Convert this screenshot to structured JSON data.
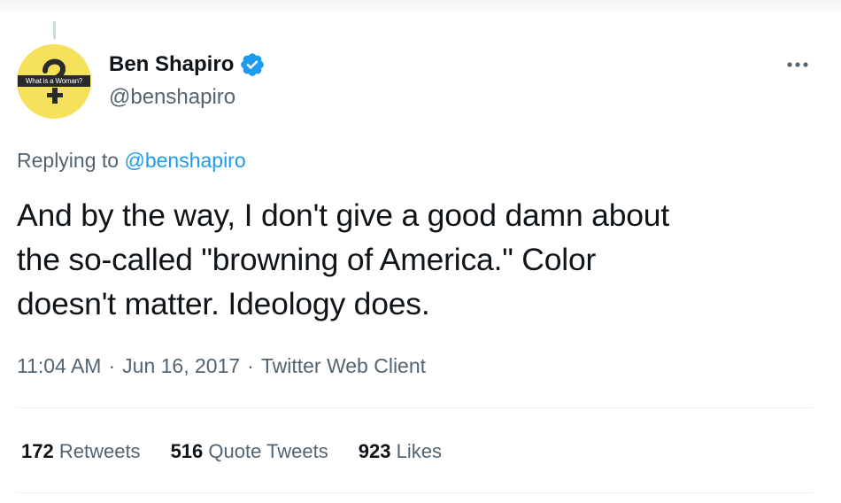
{
  "avatar": {
    "label": "What is a Woman?",
    "bg_color": "#f5e15a"
  },
  "author": {
    "display_name": "Ben Shapiro",
    "handle": "@benshapiro",
    "verified_icon": "verified-badge-icon",
    "verified_color": "#1d9bf0"
  },
  "reply": {
    "prefix": "Replying to",
    "to_handle": "@benshapiro"
  },
  "tweet": {
    "lines": [
      "And by the way, I don't give a good damn about",
      "the so-called \"browning of America.\" Color",
      "doesn't matter. Ideology does."
    ]
  },
  "meta": {
    "time": "11:04 AM",
    "separator": "·",
    "date": "Jun 16, 2017",
    "source": "Twitter Web Client"
  },
  "stats": {
    "retweets_count": "172",
    "retweets_label": "Retweets",
    "quotes_count": "516",
    "quotes_label": "Quote Tweets",
    "likes_count": "923",
    "likes_label": "Likes"
  },
  "icons": {
    "more": "more-options-icon"
  },
  "colors": {
    "link": "#1d9bf0",
    "secondary_text": "#536471",
    "primary_text": "#0f1419"
  }
}
